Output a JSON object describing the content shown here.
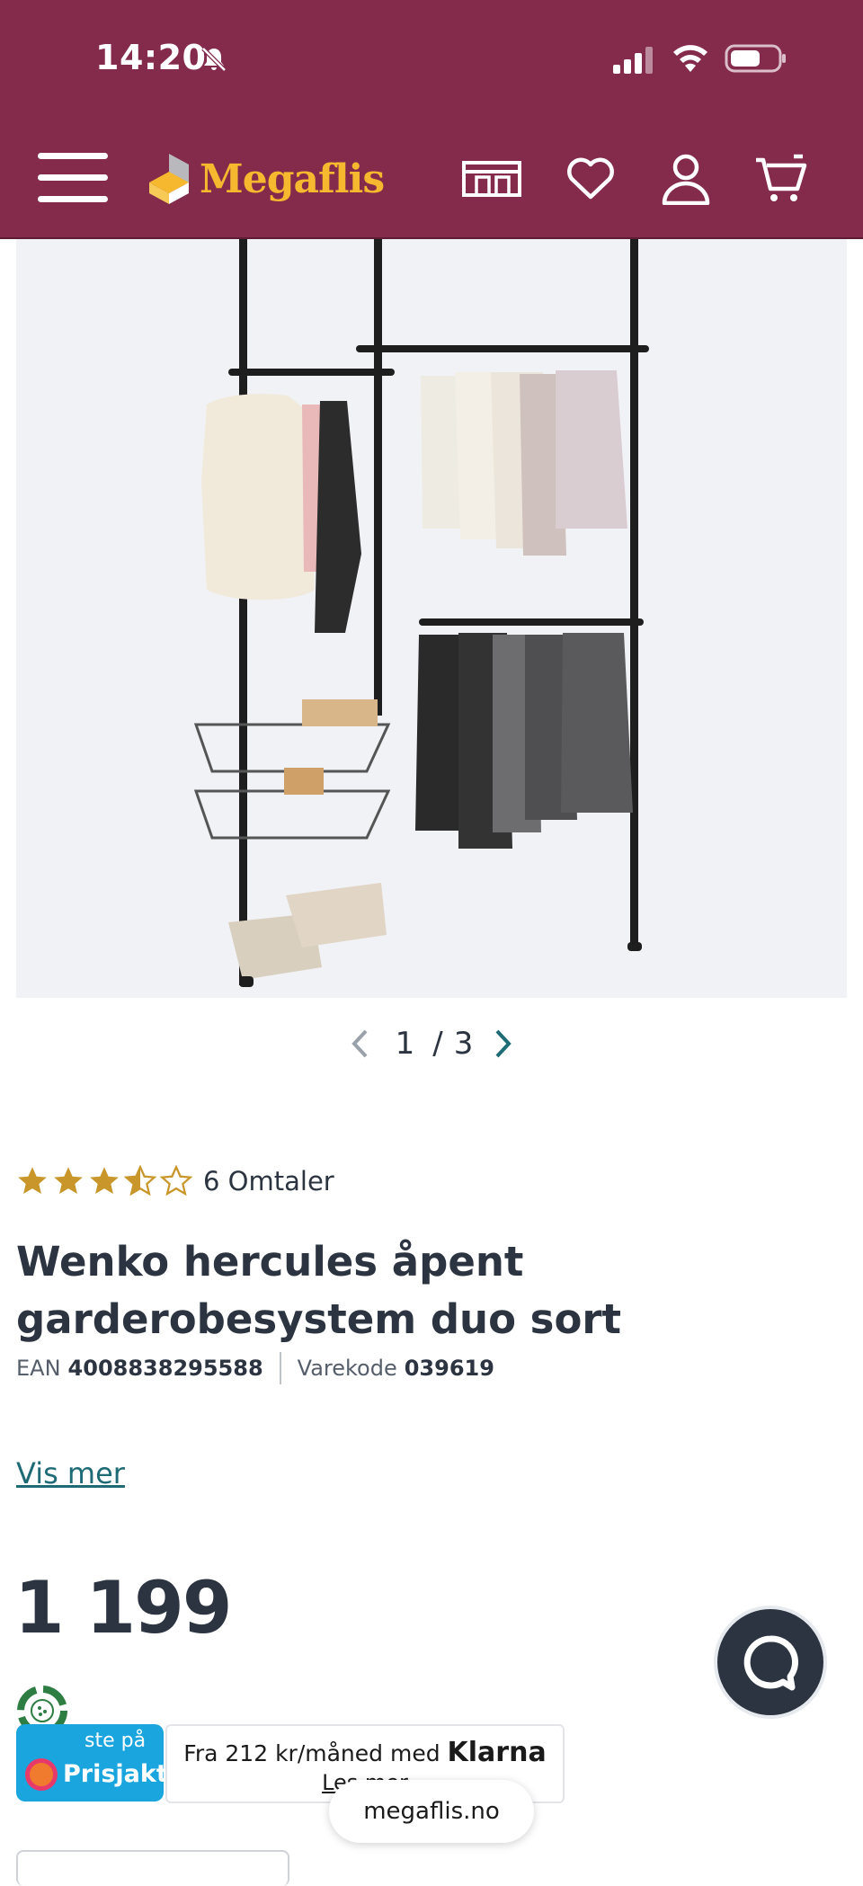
{
  "status_bar": {
    "time": "14:20"
  },
  "header": {
    "logo_text": "Megaflis",
    "brand_color": "#842b4b",
    "logo_color": "#f5b82e",
    "icons": [
      "menu-icon",
      "store-icon",
      "heart-icon",
      "user-icon",
      "cart-icon"
    ]
  },
  "gallery": {
    "current": "1",
    "separator": "/",
    "total": "3"
  },
  "product": {
    "rating": 3.5,
    "rating_max": 5,
    "reviews_label": "6 Omtaler",
    "title": "Wenko hercules åpent garderobesystem duo sort",
    "ean_label": "EAN",
    "ean_value": "4008838295588",
    "code_label": "Varekode",
    "code_value": "039619",
    "show_more": "Vis mer",
    "price": "1 199"
  },
  "prisjakt": {
    "top_text": "ste på",
    "brand": "Prisjakt"
  },
  "klarna": {
    "text": "Fra 212 kr/måned med",
    "brand": "Klarna",
    "link": "Les mer"
  },
  "browser": {
    "url": "megaflis.no"
  }
}
